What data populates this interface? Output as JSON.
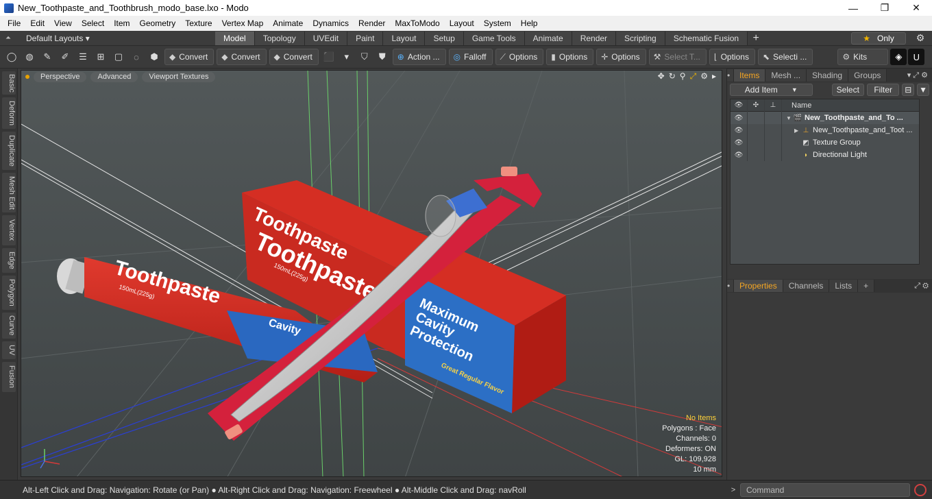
{
  "window": {
    "title": "New_Toothpaste_and_Toothbrush_modo_base.lxo - Modo",
    "controls": [
      "—",
      "❐",
      "✕"
    ]
  },
  "menu": [
    "File",
    "Edit",
    "View",
    "Select",
    "Item",
    "Geometry",
    "Texture",
    "Vertex Map",
    "Animate",
    "Dynamics",
    "Render",
    "MaxToModo",
    "Layout",
    "System",
    "Help"
  ],
  "layout_bar": {
    "layouts_label": "Default Layouts ▾",
    "tabs": [
      "Model",
      "Topology",
      "UVEdit",
      "Paint",
      "Layout",
      "Setup",
      "Game Tools",
      "Animate",
      "Render",
      "Scripting",
      "Schematic Fusion"
    ],
    "active_tab": "Model",
    "only_label": "Only"
  },
  "toolbar": {
    "convert1": "Convert",
    "convert2": "Convert",
    "convert3": "Convert",
    "action": "Action ...",
    "falloff": "Falloff",
    "options1": "Options",
    "options2": "Options",
    "options3": "Options",
    "select_t": "Select T...",
    "options4": "Options",
    "selecti": "Selecti ...",
    "kits": "Kits"
  },
  "left_tabs": [
    "Basic",
    "Deform",
    "Duplicate",
    "Mesh Edit",
    "Vertex",
    "Edge",
    "Polygon",
    "Curve",
    "UV",
    "Fusion"
  ],
  "viewport": {
    "tabs": [
      "Perspective",
      "Advanced",
      "Viewport Textures"
    ],
    "stats": {
      "no_items": "No Items",
      "polygons": "Polygons : Face",
      "channels": "Channels: 0",
      "deformers": "Deformers: ON",
      "gl": "GL: 109,928",
      "unit": "10 mm"
    },
    "scene_text": {
      "box_brand": "Toothpaste",
      "box_brand2": "Toothpaste",
      "tube_brand": "Toothpaste",
      "box_size": "150mL(225g)",
      "tube_size": "150mL(225g)",
      "box_claim1": "Maximum",
      "box_claim2": "Cavity",
      "box_claim3": "Protection",
      "box_flavor": "Great Regular Flavor",
      "tube_claim": "Cavity"
    }
  },
  "items_panel": {
    "tabs": [
      "Items",
      "Mesh ...",
      "Shading",
      "Groups"
    ],
    "active_tab": "Items",
    "add_item": "Add Item",
    "select": "Select",
    "filter": "Filter",
    "name_header": "Name",
    "rows": [
      {
        "name": "New_Toothpaste_and_To ...",
        "bold": true,
        "icon": "scene-icon"
      },
      {
        "name": "New_Toothpaste_and_Toot ...",
        "bold": false,
        "icon": "mesh-icon"
      },
      {
        "name": "Texture Group",
        "bold": false,
        "icon": "texture-icon"
      },
      {
        "name": "Directional Light",
        "bold": false,
        "icon": "light-icon"
      }
    ]
  },
  "properties_panel": {
    "tabs": [
      "Properties",
      "Channels",
      "Lists"
    ],
    "active_tab": "Properties"
  },
  "statusbar": {
    "hint": "Alt-Left Click and Drag: Navigation: Rotate (or Pan) ● Alt-Right Click and Drag: Navigation: Freewheel ● Alt-Middle Click and Drag: navRoll",
    "command_placeholder": "Command"
  }
}
